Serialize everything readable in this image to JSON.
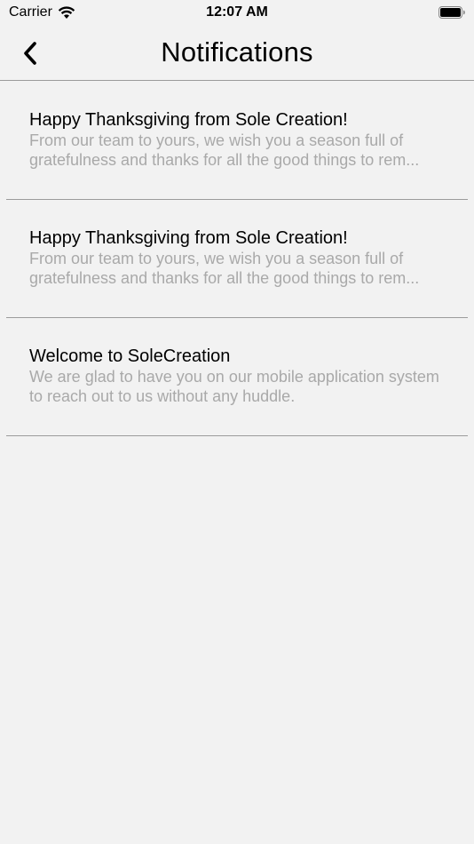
{
  "status_bar": {
    "carrier": "Carrier",
    "time": "12:07 AM"
  },
  "nav": {
    "title": "Notifications",
    "back_icon": "chevron-left-icon"
  },
  "notifications": [
    {
      "title": "Happy Thanksgiving from Sole Creation!",
      "body": "From our team to yours, we wish you a season full of gratefulness and thanks for all the good things to rem..."
    },
    {
      "title": "Happy Thanksgiving from Sole Creation!",
      "body": "From our team to yours, we wish you a season full of gratefulness and thanks for all the good things to rem..."
    },
    {
      "title": "Welcome to SoleCreation",
      "body": "We are glad to have you on our mobile application system to reach out to us without any huddle."
    }
  ],
  "colors": {
    "background": "#f2f2f2",
    "divider": "#9b9b9b",
    "body_text": "#a9a9a9"
  }
}
